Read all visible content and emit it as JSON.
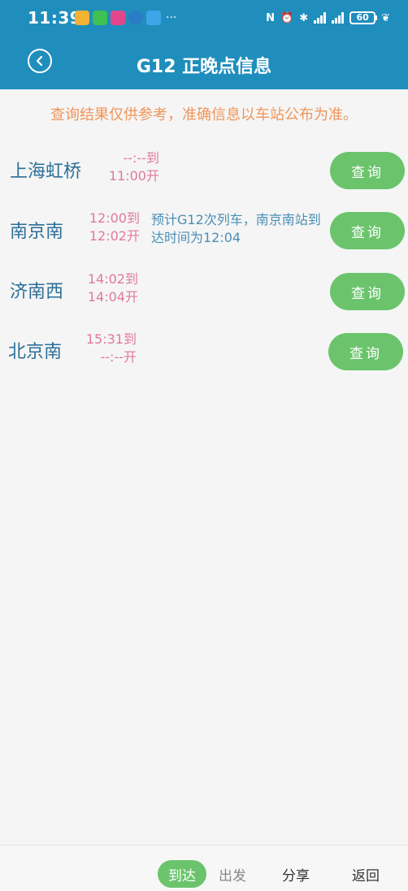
{
  "status_bar": {
    "time": "11:39",
    "battery": "60",
    "apps": [
      {
        "name": "gallery-app-icon",
        "color": "#f2b233"
      },
      {
        "name": "wechat-app-icon",
        "color": "#3fc151"
      },
      {
        "name": "social-app-icon",
        "color": "#e2468c"
      },
      {
        "name": "qq-app-icon",
        "color": "#2a7cc7"
      },
      {
        "name": "browser-app-icon",
        "color": "#3da5e8"
      }
    ],
    "more": "···"
  },
  "header": {
    "title": "G12 正晚点信息",
    "background": "#1f8ebd"
  },
  "notice": "查询结果仅供参考，准确信息以车站公布为准。",
  "stations": [
    {
      "name": "上海虹桥",
      "arrive": "--:--到",
      "depart": "11:00开",
      "info": "",
      "button": "查询"
    },
    {
      "name": "南京南",
      "arrive": "12:00到",
      "depart": "12:02开",
      "info": "预计G12次列车，南京南站到达时间为12:04",
      "button": "查询"
    },
    {
      "name": "济南西",
      "arrive": "14:02到",
      "depart": "14:04开",
      "info": "",
      "button": "查询"
    },
    {
      "name": "北京南",
      "arrive": "15:31到",
      "depart": "--:--开",
      "info": "",
      "button": "查询"
    }
  ],
  "bottom_nav": {
    "arrive": "到达",
    "depart": "出发",
    "share": "分享",
    "back": "返回"
  },
  "colors": {
    "accent_green": "#6bc46c",
    "station_text": "#2c6f98",
    "time_text": "#e07a9a",
    "notice_text": "#f0955a"
  }
}
